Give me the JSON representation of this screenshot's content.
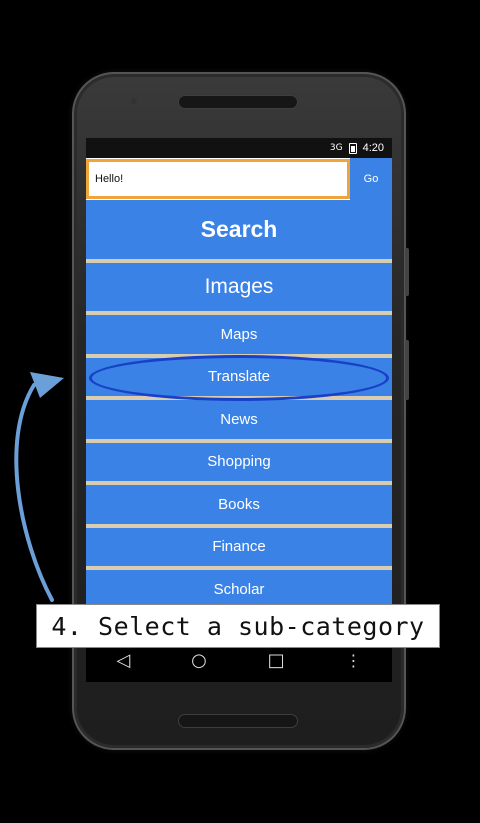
{
  "statusbar": {
    "signal": "3G",
    "time": "4:20"
  },
  "search": {
    "value": "Hello!",
    "go_label": "Go"
  },
  "menu": {
    "items": [
      {
        "label": "Search"
      },
      {
        "label": "Images"
      },
      {
        "label": "Maps"
      },
      {
        "label": "Translate"
      },
      {
        "label": "News"
      },
      {
        "label": "Shopping"
      },
      {
        "label": "Books"
      },
      {
        "label": "Finance"
      },
      {
        "label": "Scholar"
      }
    ]
  },
  "navigation": {
    "back_icon": "back-triangle-icon",
    "home_icon": "home-circle-icon",
    "recents_icon": "recents-square-icon",
    "overflow_icon": "overflow-dots-icon"
  },
  "annotation": {
    "caption": "4. Select a sub-category",
    "highlighted_item": "Translate"
  },
  "colors": {
    "menu_blue": "#3a82e6",
    "input_border": "#f0a53a",
    "highlight_ring": "#1940c8",
    "arrow": "#6a9fd8"
  }
}
